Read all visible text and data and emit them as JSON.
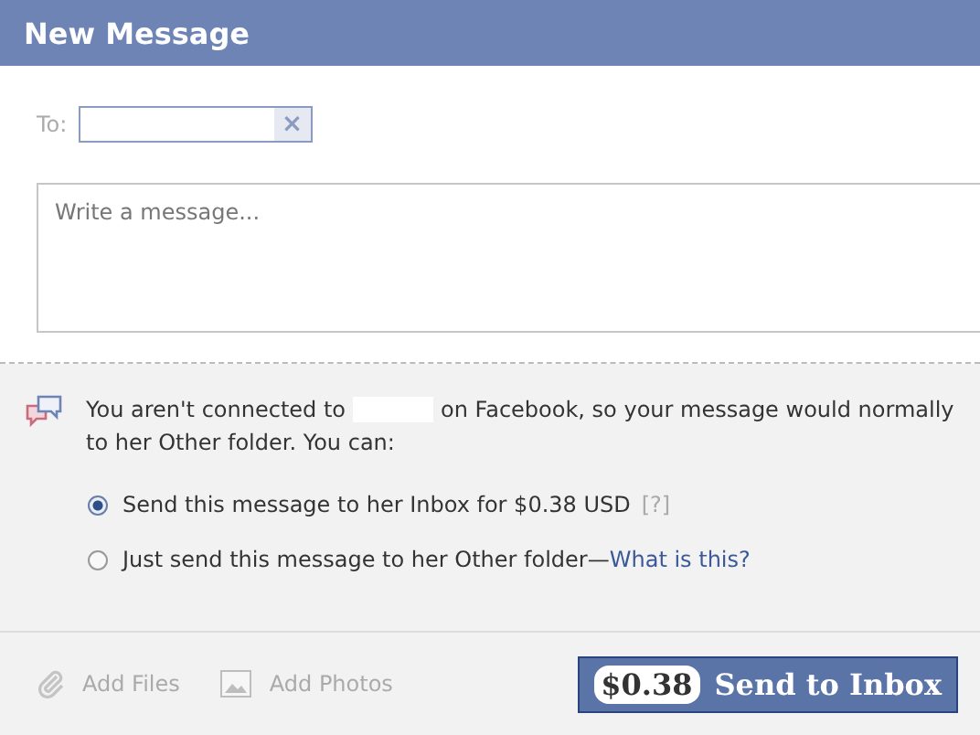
{
  "window": {
    "title": "New Message"
  },
  "to": {
    "label": "To:",
    "clear": "×"
  },
  "message": {
    "placeholder": "Write a message..."
  },
  "notice": {
    "before": "You aren't connected to",
    "after": "on Facebook, so your message would normally",
    "line2": "to her Other folder. You can:"
  },
  "options": [
    {
      "text": "Send this message to her Inbox for $0.38 USD",
      "help": "[?]",
      "selected": true
    },
    {
      "text": "Just send this message to her Other folder—",
      "link": "What is this?",
      "selected": false
    }
  ],
  "footer": {
    "add_files": "Add Files",
    "add_photos": "Add Photos",
    "price": "$0.38",
    "send": "Send to Inbox"
  }
}
